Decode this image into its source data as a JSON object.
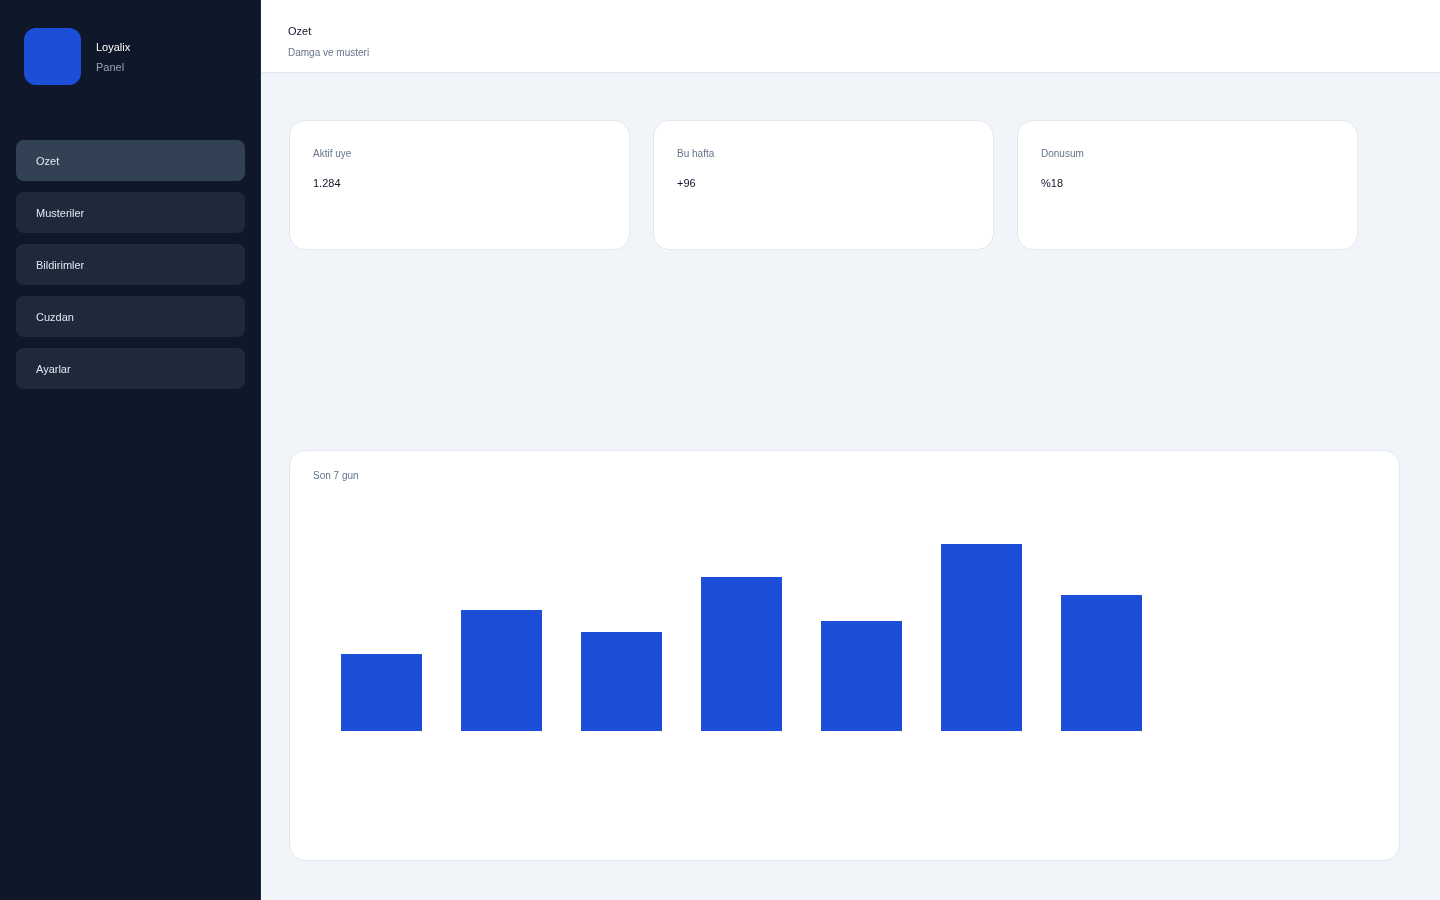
{
  "brand": {
    "name": "Loyalix",
    "subtitle": "Panel"
  },
  "sidebar": {
    "items": [
      {
        "label": "Ozet",
        "selected": true
      },
      {
        "label": "Musteriler",
        "selected": false
      },
      {
        "label": "Bildirimler",
        "selected": false
      },
      {
        "label": "Cuzdan",
        "selected": false
      },
      {
        "label": "Ayarlar",
        "selected": false
      }
    ]
  },
  "header": {
    "title": "Ozet",
    "subtitle": "Damga ve musteri"
  },
  "stats": [
    {
      "label": "Aktif uye",
      "value": "1.284"
    },
    {
      "label": "Bu hafta",
      "value": "+96"
    },
    {
      "label": "Donusum",
      "value": "%18"
    }
  ],
  "chart": {
    "title": "Son 7 gun"
  }
}
